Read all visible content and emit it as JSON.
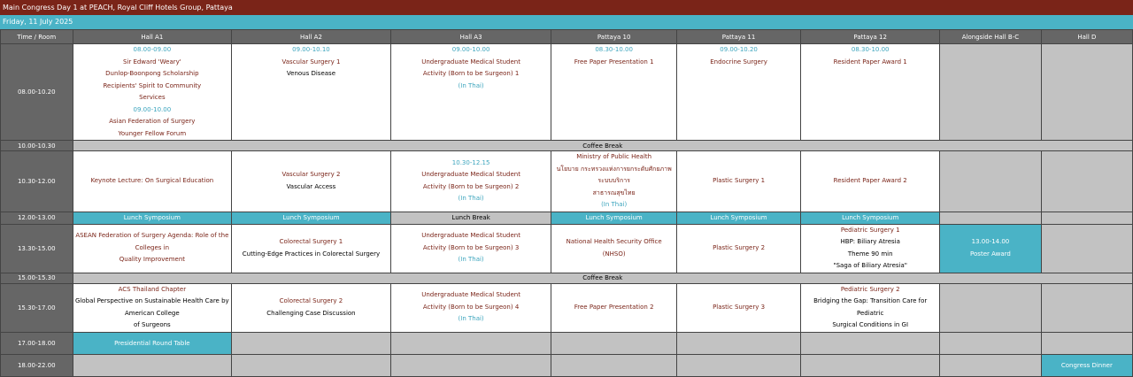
{
  "header": {
    "title": "Main Congress Day 1 at PEACH, Royal Cliff Hotels Group, Pattaya",
    "date": "Friday, 11 July 2025"
  },
  "columns": [
    "Time / Room",
    "Hall A1",
    "Hall A2",
    "Hall A3",
    "Pattaya 10",
    "Pattaya 11",
    "Pattaya 12",
    "Alongside Hall B-C",
    "Hall D"
  ],
  "rows": {
    "r1": {
      "time": "08.00-10.20",
      "a1": {
        "l1": "08.00-09.00",
        "l2": "Sir Edward 'Weary'",
        "l3": "Dunlop-Boonpong Scholarship",
        "l4": "Recipients' Spirit to Community",
        "l5": "Services",
        "l6": "09.00-10.00",
        "l7": "Asian Federation of Surgery",
        "l8": "Younger Fellow Forum"
      },
      "a2": {
        "l1": "09.00-10.10",
        "l2": "Vascular Surgery 1",
        "l3": "Venous Disease"
      },
      "a3": {
        "l1": "09.00-10.00",
        "l2": "Undergraduate Medical Student",
        "l3": "Activity (Born to be Surgeon) 1",
        "l4": "(In Thai)"
      },
      "p10": {
        "l1": "08.30-10.00",
        "l2": "Free Paper Presentation 1"
      },
      "p11": {
        "l1": "09.00-10.20",
        "l2": "Endocrine Surgery"
      },
      "p12": {
        "l1": "08.30-10.00",
        "l2": "Resident Paper Award 1"
      }
    },
    "r2": {
      "time": "10.00-10.30",
      "label": "Coffee Break"
    },
    "r3": {
      "time": "10.30-12.00",
      "a1": {
        "l1": "Keynote Lecture: On Surgical Education"
      },
      "a2": {
        "l1": "Vascular Surgery 2",
        "l2": "Vascular Access"
      },
      "a3": {
        "l1": "10.30-12.15",
        "l2": "Undergraduate Medical Student",
        "l3": "Activity (Born to be Surgeon) 2",
        "l4": "(In Thai)"
      },
      "p10": {
        "l1": "Ministry of Public Health",
        "l2": "นโยบาย กระทรวงแห่งการยกระดับศักยภาพระบบบริการ",
        "l3": "สาธารณสุขไทย",
        "l4": "(In Thai)"
      },
      "p11": {
        "l1": "Plastic Surgery 1"
      },
      "p12": {
        "l1": "Resident Paper Award 2"
      }
    },
    "r4": {
      "time": "12.00-13.00",
      "a1": "Lunch Symposium",
      "a2": "Lunch Symposium",
      "a3": "Lunch Break",
      "p10": "Lunch Symposium",
      "p11": "Lunch Symposium",
      "p12": "Lunch Symposium"
    },
    "r5": {
      "time": "13.30-15.00",
      "a1": {
        "l1": "ASEAN Federation of Surgery Agenda: Role of the",
        "l2": "Colleges in",
        "l3": "Quality Improvement"
      },
      "a2": {
        "l1": "Colorectal Surgery 1",
        "l2": "Cutting-Edge Practices in Colorectal Surgery"
      },
      "a3": {
        "l1": "Undergraduate Medical Student",
        "l2": "Activity (Born to be Surgeon) 3",
        "l3": "(In Thai)"
      },
      "p10": {
        "l1": "National Health Security Office",
        "l2": "(NHSO)"
      },
      "p11": {
        "l1": "Plastic Surgery 2"
      },
      "p12": {
        "l1": "Pediatric Surgery 1",
        "l2": "HBP: Biliary Atresia",
        "l3": "Theme 90 min",
        "l4": "\"Saga of Biliary Atresia\""
      },
      "bc": {
        "l1": "13.00-14.00",
        "l2": "Poster Award"
      }
    },
    "r6": {
      "time": "15.00-15.30",
      "label": "Coffee Break"
    },
    "r7": {
      "time": "15.30-17.00",
      "a1": {
        "l1": "ACS Thailand Chapter",
        "l2": "Global Perspective on Sustainable Health Care by",
        "l3": "American College",
        "l4": "of Surgeons"
      },
      "a2": {
        "l1": "Colorectal Surgery 2",
        "l2": "Challenging Case Discussion"
      },
      "a3": {
        "l1": "Undergraduate Medical Student",
        "l2": "Activity (Born to be Surgeon) 4",
        "l3": "(In Thai)"
      },
      "p10": {
        "l1": "Free Paper Presentation 2"
      },
      "p11": {
        "l1": "Plastic Surgery 3"
      },
      "p12": {
        "l1": "Pediatric Surgery 2",
        "l2": "Bridging the Gap: Transition Care for Pediatric",
        "l3": "Surgical Conditions in GI"
      }
    },
    "r8": {
      "time": "17.00-18.00",
      "a1": "Presidential Round Table"
    },
    "r9": {
      "time": "18.00-22.00",
      "hd": "Congress Dinner"
    }
  },
  "colors": {
    "title_bg": "#7a2418",
    "accent": "#4ab3c6",
    "header_bg": "#666666",
    "empty_bg": "#c2c2c2",
    "session_text": "#7a2418",
    "time_text": "#3ba4bd"
  }
}
